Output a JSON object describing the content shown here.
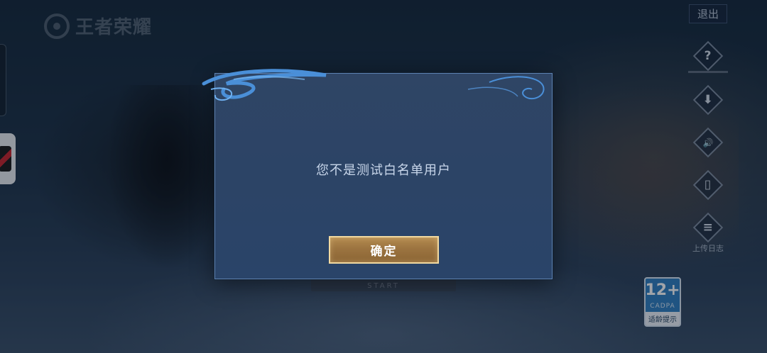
{
  "logo": {
    "text": "王者荣耀"
  },
  "header": {
    "exit_label": "退出"
  },
  "right_panel": {
    "items": [
      {
        "icon": "help-icon",
        "glyph": "?",
        "label": ""
      },
      {
        "icon": "download-icon",
        "glyph": "⬇",
        "label": ""
      },
      {
        "icon": "speaker-icon",
        "glyph": "🔊",
        "label": ""
      },
      {
        "icon": "phone-icon",
        "glyph": "▯",
        "label": ""
      },
      {
        "icon": "clipboard-icon",
        "glyph": "≡",
        "label": "上传日志"
      }
    ]
  },
  "age_rating": {
    "number": "12+",
    "org": "CADPA",
    "tip": "适龄提示"
  },
  "background": {
    "start_label": "START"
  },
  "dialog": {
    "message": "您不是测试白名单用户",
    "confirm_label": "确定"
  },
  "colors": {
    "dialog_bg": "#2c4466",
    "dialog_border": "#6e96c8",
    "button_gold": "#9c7440",
    "button_border": "#f2d9a0",
    "message_text": "#c8d6ea"
  }
}
